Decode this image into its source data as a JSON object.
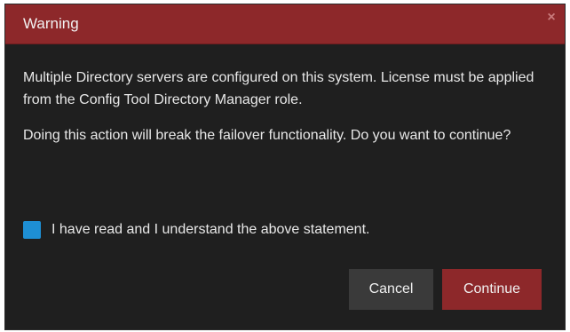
{
  "dialog": {
    "title": "Warning",
    "close_glyph": "×",
    "message_1": "Multiple Directory servers are configured on this system. License must be applied from the Config Tool Directory Manager role.",
    "message_2": "Doing this action will break the failover functionality. Do you want to continue?",
    "acknowledge_label": "I have read and I understand the above statement.",
    "acknowledge_checked": true,
    "cancel_label": "Cancel",
    "continue_label": "Continue"
  },
  "colors": {
    "title_bar": "#8d282a",
    "dialog_bg": "#1f1f1f",
    "checkbox": "#1e8fd4",
    "cancel_bg": "#3a3a3a",
    "continue_bg": "#8d282a"
  },
  "icons": {
    "close": "close-icon",
    "checkbox": "checkbox-checked"
  }
}
